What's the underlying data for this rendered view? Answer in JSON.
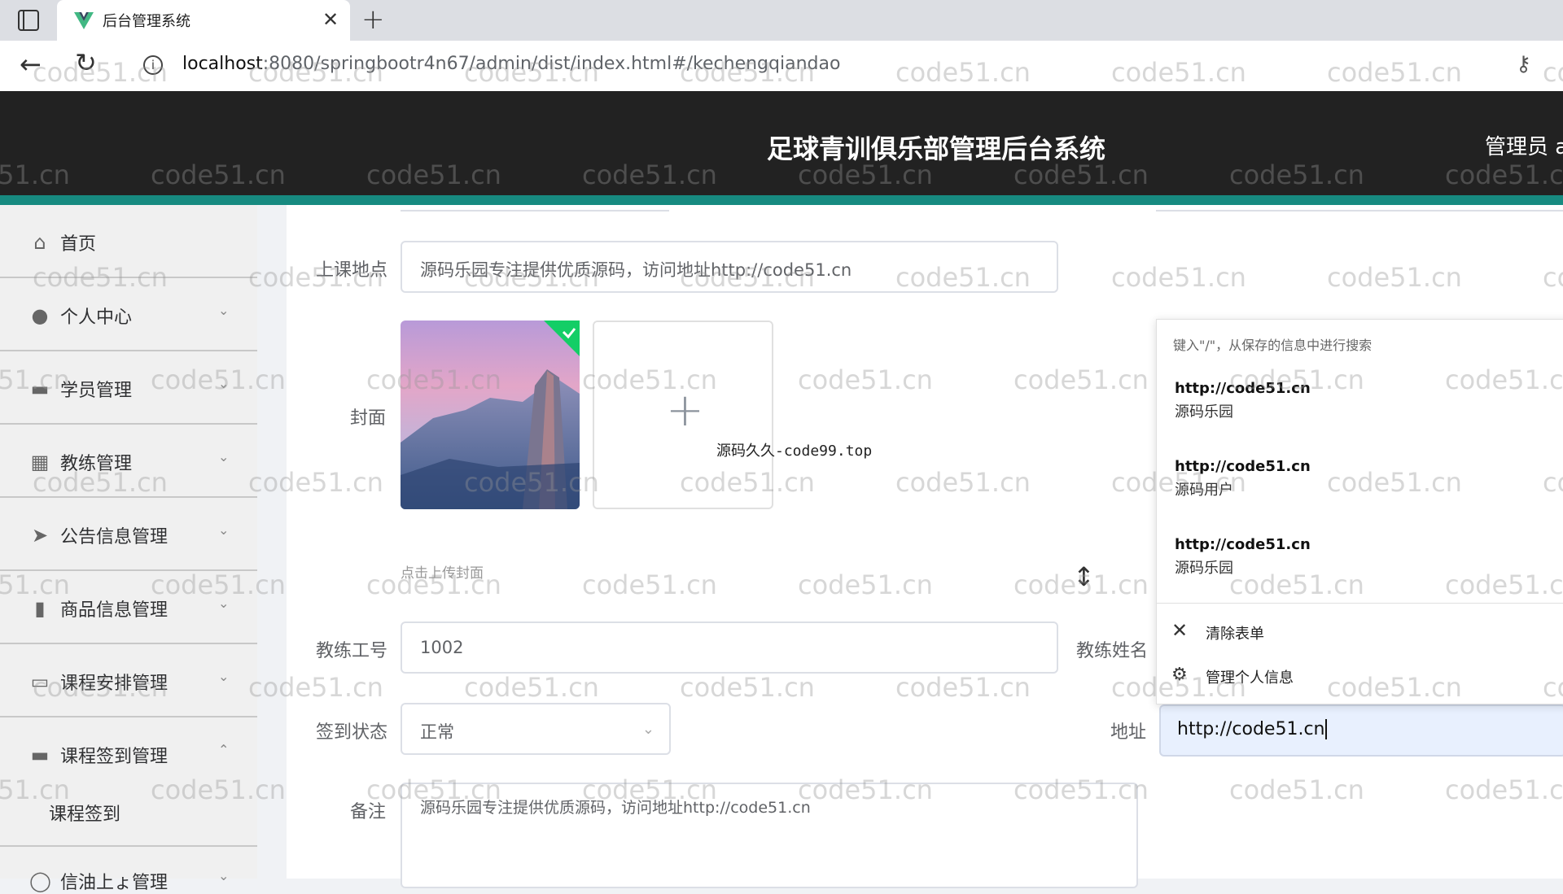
{
  "browser": {
    "tab_title": "后台管理系统",
    "url_host": "localhost",
    "url_rest": ":8080/springbootr4n67/admin/dist/index.html#/kechengqiandao"
  },
  "header": {
    "title": "足球青训俱乐部管理后台系统",
    "admin": "管理员 al"
  },
  "sidebar": {
    "items": [
      {
        "label": "首页",
        "icon": "home-icon"
      },
      {
        "label": "个人中心",
        "icon": "user-icon"
      },
      {
        "label": "学员管理",
        "icon": "chat-icon"
      },
      {
        "label": "教练管理",
        "icon": "grid-icon"
      },
      {
        "label": "公告信息管理",
        "icon": "send-icon"
      },
      {
        "label": "商品信息管理",
        "icon": "bar-chart-icon"
      },
      {
        "label": "课程安排管理",
        "icon": "monitor-icon"
      },
      {
        "label": "课程签到管理",
        "icon": "ticket-icon"
      }
    ],
    "submenu": {
      "label": "课程签到"
    },
    "partial_item": "信油上ょ管理"
  },
  "form": {
    "location_label": "上课地点",
    "location_value": "源码乐园专注提供优质源码，访问地址http://code51.cn",
    "cover_label": "封面",
    "upload_hint": "点击上传封面",
    "overlay_text": "源码久久-code99.top",
    "coach_id_label": "教练工号",
    "coach_id_value": "1002",
    "coach_name_label": "教练姓名",
    "status_label": "签到状态",
    "status_value": "正常",
    "address_label": "地址",
    "address_value": "http://code51.cn",
    "notes_label": "备注",
    "notes_value": "源码乐园专注提供优质源码，访问地址http://code51.cn"
  },
  "autofill": {
    "hint": "键入\"/\"，从保存的信息中进行搜索",
    "entries": [
      {
        "url": "http://code51.cn",
        "name": "源码乐园"
      },
      {
        "url": "http://code51.cn",
        "name": "源码用户"
      },
      {
        "url": "http://code51.cn",
        "name": "源码乐园"
      }
    ],
    "clear": "清除表单",
    "manage": "管理个人信息"
  },
  "watermark": "code51.cn",
  "colors": {
    "header_bg": "#222222",
    "accent_bar": "#178a80",
    "sidebar_bg": "#f0f0f0",
    "autofill_highlight": "#e8f0fe"
  }
}
